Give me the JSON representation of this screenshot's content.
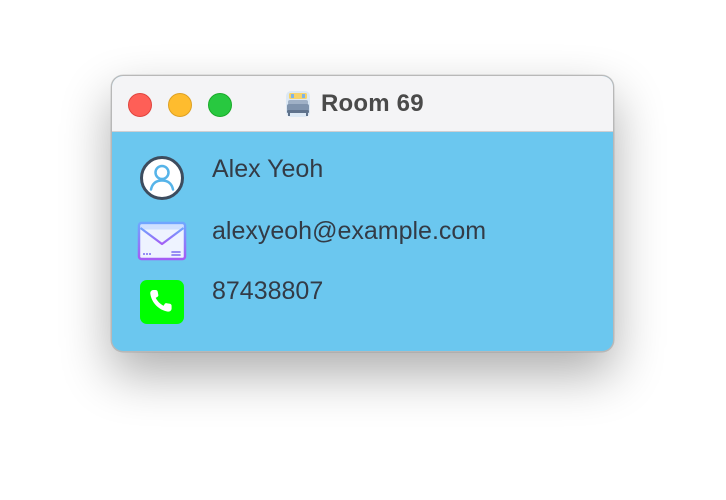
{
  "window": {
    "title": "Room 69",
    "app_icon": "room-bed-icon",
    "controls": [
      "close",
      "minimize",
      "zoom"
    ],
    "colors": {
      "content_background": "#6bc7ef",
      "titlebar_background": "#f4f4f6"
    }
  },
  "contact": {
    "name": {
      "icon": "person-icon",
      "value": "Alex Yeoh"
    },
    "email": {
      "icon": "envelope-icon",
      "value": "alexyeoh@example.com"
    },
    "phone": {
      "icon": "phone-icon",
      "value": "87438807"
    }
  }
}
